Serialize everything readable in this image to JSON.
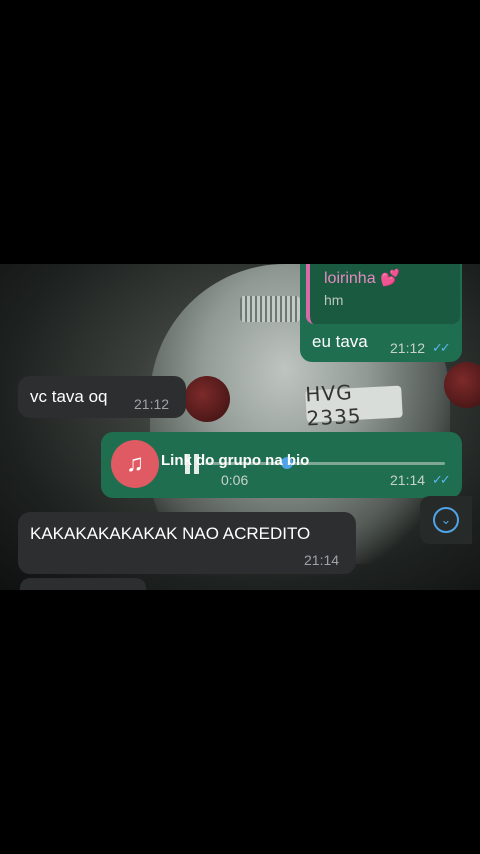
{
  "messages": {
    "reply": {
      "quote_name": "loirinha 💕",
      "quote_text": "hm",
      "text": "eu tava",
      "time": "21:12"
    },
    "incoming_1": {
      "text": "vc tava oq",
      "time": "21:12"
    },
    "audio": {
      "overlay_text": "Link do grupo na bio",
      "duration": "0:06",
      "time": "21:14",
      "avatar_icon": "music-note-icon"
    },
    "incoming_2": {
      "text": "KAKAKAKAKAKAK NAO ACREDITO",
      "time": "21:14"
    }
  },
  "wallpaper": {
    "plate": "HVG 2335"
  },
  "colors": {
    "outgoing": "#1f6e4f",
    "incoming": "#2c2e30",
    "tick": "#5ab7f0",
    "avatar": "#e05a64"
  }
}
